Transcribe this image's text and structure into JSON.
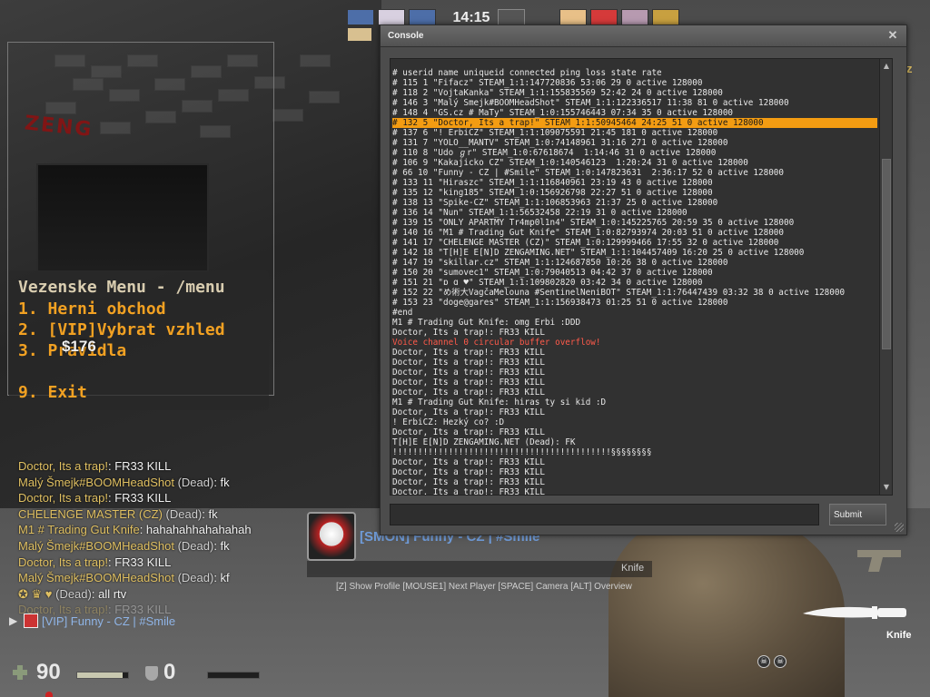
{
  "topbar": {
    "timer": "14:15",
    "ct_slot_colors": [
      "#4d6ea8",
      "#d8d0e0",
      "#4d6ea8"
    ],
    "t_slot_colors": [
      "#e8c088",
      "#d53a3a",
      "#b79ab0",
      "#c8a040"
    ],
    "mid_icon": "nip-logo-icon",
    "score_left": "",
    "score_right": ""
  },
  "graffiti_text": "ZENG",
  "menu": {
    "title": "Vezenske Menu - /menu",
    "items": [
      "1. Herni obchod",
      "2. [VIP]Vybrat vzhled",
      "3. Pravidla",
      "9. Exit"
    ]
  },
  "money": "$176",
  "chat": [
    {
      "name": "Doctor, Its a trap!",
      "dead": "",
      "text": ": FR33 KILL"
    },
    {
      "name": "Malý Šmejk#BOOMHeadShot",
      "dead": " (Dead)",
      "text": ": fk"
    },
    {
      "name": "Doctor, Its a trap!",
      "dead": "",
      "text": ": FR33 KILL"
    },
    {
      "name": "CHELENGE MASTER (CZ)",
      "dead": " (Dead)",
      "text": ": fk"
    },
    {
      "name": "M1 # Trading Gut Knife",
      "dead": "",
      "text": ": hahahahhahahahah"
    },
    {
      "name": "Malý Šmejk#BOOMHeadShot",
      "dead": " (Dead)",
      "text": ": fk"
    },
    {
      "name": "Doctor, Its a trap!",
      "dead": "",
      "text": ": FR33 KILL"
    },
    {
      "name": "Malý Šmejk#BOOMHeadShot",
      "dead": " (Dead)",
      "text": ": kf"
    },
    {
      "name": "✪ ♛ ♥",
      "dead": " (Dead)",
      "text": ": all rtv"
    },
    {
      "name": "Doctor, Its a trap!",
      "dead": "",
      "text": ": FR33 KILL"
    }
  ],
  "voice": {
    "speaker_icon": "speaker-icon",
    "name": "[VIP] Funny - CZ | #Smile"
  },
  "spectator": {
    "name": "[SMON] Funny - CZ | #Smile",
    "weapon": "Knife",
    "hints": "[Z] Show Profile  [MOUSE1] Next Player [SPACE] Camera  [ALT] Overview"
  },
  "weapons_panel": {
    "knife_label": "Knife",
    "pistol_icon": "pistol-icon",
    "knife_icon": "knife-icon"
  },
  "hud": {
    "health": "90",
    "armor": "0",
    "health_fraction": 0.9
  },
  "partial_right_text": "z",
  "console": {
    "title": "Console",
    "close_glyph": "✕",
    "submit_label": "Submit",
    "input_value": "",
    "highlight_color": "#f39c12",
    "lines": [
      {
        "t": "# userid name uniqueid connected ping loss state rate",
        "k": ""
      },
      {
        "t": "# 115 1 \"Fifacz\" STEAM_1:1:147720836 53:06 29 0 active 128000",
        "k": ""
      },
      {
        "t": "# 118 2 \"VojtaKanka\" STEAM_1:1:155835569 52:42 24 0 active 128000",
        "k": ""
      },
      {
        "t": "# 146 3 \"Malý Šmejk#BOOMHeadShot\" STEAM_1:1:122336517 11:38 81 0 active 128000",
        "k": ""
      },
      {
        "t": "# 148 4 \"GS.cz # MaTy\" STEAM_1:0:155746443 07:34 35 0 active 128000",
        "k": ""
      },
      {
        "t": "# 132 5 \"Doctor, Its a trap!\" STEAM_1:1:50945464 24:25 51 0 active 128000",
        "k": "hl"
      },
      {
        "t": "# 137 6 \"! ErbiCZ\" STEAM_1:1:109075591 21:45 181 0 active 128000",
        "k": ""
      },
      {
        "t": "# 131 7 \"YOLO__MANTV\" STEAM_1:0:74148961 31:16 271 0 active 128000",
        "k": ""
      },
      {
        "t": "# 110 8 \"Udo ℊr\" STEAM_1:0:67618674  1:14:46 31 0 active 128000",
        "k": ""
      },
      {
        "t": "# 106 9 \"Kakajicko CZ\" STEAM_1:0:140546123  1:20:24 31 0 active 128000",
        "k": ""
      },
      {
        "t": "# 66 10 \"Funny - CZ | #Smile\" STEAM_1:0:147823631  2:36:17 52 0 active 128000",
        "k": ""
      },
      {
        "t": "# 133 11 \"Hiraszc\" STEAM_1:1:116840961 23:19 43 0 active 128000",
        "k": ""
      },
      {
        "t": "# 135 12 \"king185\" STEAM_1:0:156926798 22:27 51 0 active 128000",
        "k": ""
      },
      {
        "t": "# 138 13 \"Spike-CZ\" STEAM_1:1:106853963 21:37 25 0 active 128000",
        "k": ""
      },
      {
        "t": "# 136 14 \"Nun\" STEAM_1:1:56532458 22:19 31 0 active 128000",
        "k": ""
      },
      {
        "t": "# 139 15 \"ONLY APARTMY Tr4mp0l1n4\" STEAM_1:0:145225765 20:59 35 0 active 128000",
        "k": ""
      },
      {
        "t": "# 140 16 \"M1 # Trading Gut Knife\" STEAM_1:0:82793974 20:03 51 0 active 128000",
        "k": ""
      },
      {
        "t": "# 141 17 \"CHELENGE MASTER (CZ)\" STEAM_1:0:129999466 17:55 32 0 active 128000",
        "k": ""
      },
      {
        "t": "# 142 18 \"T[H]E E[N]D ZENGAMING.NET\" STEAM_1:1:104457409 16:20 25 0 active 128000",
        "k": ""
      },
      {
        "t": "# 147 19 \"skillar.cz\" STEAM_1:1:124687850 10:26 38 0 active 128000",
        "k": ""
      },
      {
        "t": "# 150 20 \"sumovec1\" STEAM_1:0:79040513 04:42 37 0 active 128000",
        "k": ""
      },
      {
        "t": "# 151 21 \"ɒ ɑ ♥\" STEAM_1:1:109802820 03:42 34 0 active 128000",
        "k": ""
      },
      {
        "t": "# 152 22 \"め術大VagčaMelouna #SentinelNeniBOT\" STEAM_1:1:76447439 03:32 38 0 active 128000",
        "k": ""
      },
      {
        "t": "# 153 23 \"doge@gares\" STEAM_1:1:156938473 01:25 51 0 active 128000",
        "k": ""
      },
      {
        "t": "#end",
        "k": ""
      },
      {
        "t": "M1 # Trading Gut Knife: omg Erbi :DDD",
        "k": ""
      },
      {
        "t": "Doctor, Its a trap!: FR33 KILL",
        "k": ""
      },
      {
        "t": "Voice channel 0 circular buffer overflow!",
        "k": "err"
      },
      {
        "t": "Doctor, Its a trap!: FR33 KILL",
        "k": ""
      },
      {
        "t": "Doctor, Its a trap!: FR33 KILL",
        "k": ""
      },
      {
        "t": "Doctor, Its a trap!: FR33 KILL",
        "k": ""
      },
      {
        "t": "Doctor, Its a trap!: FR33 KILL",
        "k": ""
      },
      {
        "t": "Doctor, Its a trap!: FR33 KILL",
        "k": ""
      },
      {
        "t": "M1 # Trading Gut Knife: hiras ty si kid :D",
        "k": ""
      },
      {
        "t": "Doctor, Its a trap!: FR33 KILL",
        "k": ""
      },
      {
        "t": "! ErbiCZ: Hezký co? :D",
        "k": ""
      },
      {
        "t": "Doctor, Its a trap!: FR33 KILL",
        "k": ""
      },
      {
        "t": "T[H]E E[N]D ZENGAMING.NET (Dead): FK",
        "k": ""
      },
      {
        "t": "!!!!!!!!!!!!!!!!!!!!!!!!!!!!!!!!!!!!!!!!!!!§§§§§§§§",
        "k": ""
      },
      {
        "t": "Doctor, Its a trap!: FR33 KILL",
        "k": ""
      },
      {
        "t": "Doctor, Its a trap!: FR33 KILL",
        "k": ""
      },
      {
        "t": "Doctor, Its a trap!: FR33 KILL",
        "k": ""
      },
      {
        "t": "Doctor, Its a trap!: FR33 KILL",
        "k": ""
      },
      {
        "t": "Doctor, Its a trap!: FR33 KILL",
        "k": ""
      }
    ]
  }
}
